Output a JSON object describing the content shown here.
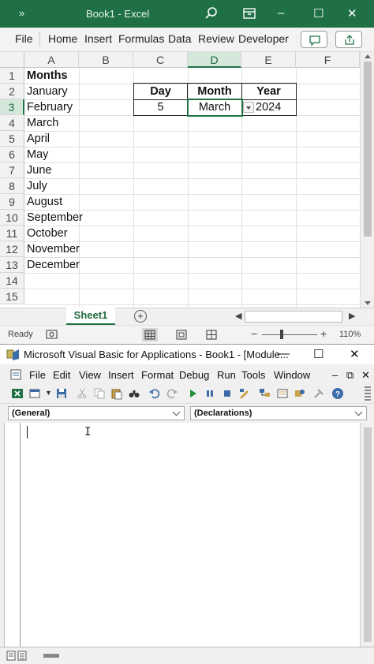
{
  "excel": {
    "title": "Book1  -  Excel",
    "qa_chevron": "»",
    "window_controls": {
      "minimize": "–",
      "maximize": "☐",
      "close": "✕"
    },
    "tabs": [
      "File",
      "Home",
      "Insert",
      "Formulas",
      "Data",
      "Review",
      "Developer"
    ],
    "columns": [
      "A",
      "B",
      "C",
      "D",
      "E",
      "F"
    ],
    "selected_column": "D",
    "rows": [
      "1",
      "2",
      "3",
      "4",
      "5",
      "6",
      "7",
      "8",
      "9",
      "10",
      "11",
      "12",
      "13",
      "14",
      "15"
    ],
    "selected_row": "3",
    "column_a": [
      "Months",
      "January",
      "February",
      "March",
      "April",
      "May",
      "June",
      "July",
      "August",
      "September",
      "October",
      "November",
      "December"
    ],
    "table": {
      "headers": [
        "Day",
        "Month",
        "Year"
      ],
      "values": [
        "5",
        "March",
        "2024"
      ]
    },
    "sheet_tab": "Sheet1",
    "add_sheet": "+",
    "status": {
      "ready": "Ready",
      "zoom": "110%",
      "minus": "−",
      "plus": "+"
    }
  },
  "vba": {
    "title": "Microsoft Visual Basic for Applications - Book1 - [Module...",
    "window_controls": {
      "minimize": "—",
      "maximize": "☐",
      "close": "✕"
    },
    "menu": [
      "File",
      "Edit",
      "View",
      "Insert",
      "Format",
      "Debug",
      "Run",
      "Tools",
      "Window"
    ],
    "doc_controls": {
      "minimize": "–",
      "restore": "⧉",
      "close": "✕"
    },
    "object_combo": "(General)",
    "procedure_combo": "(Declarations)"
  }
}
